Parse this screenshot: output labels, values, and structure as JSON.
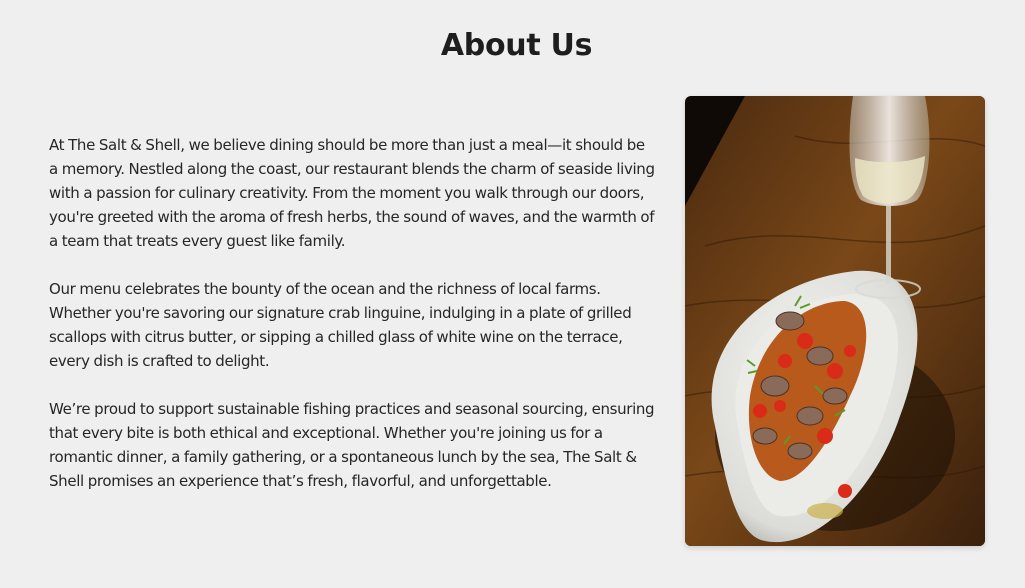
{
  "about": {
    "title": "About Us",
    "paragraphs": [
      "At The Salt & Shell, we believe dining should be more than just a meal—it should be a memory. Nestled along the coast, our restaurant blends the charm of seaside living with a passion for culinary creativity. From the moment you walk through our doors, you're greeted with the aroma of fresh herbs, the sound of waves, and the warmth of a team that treats every guest like family.",
      "Our menu celebrates the bounty of the ocean and the richness of local farms. Whether you're savoring our signature crab linguine, indulging in a plate of grilled scallops with citrus butter, or sipping a chilled glass of white wine on the terrace, every dish is crafted to delight.",
      "We’re proud to support sustainable fishing practices and seasonal sourcing, ensuring that every bite is both ethical and exceptional. Whether you're joining us for a romantic dinner, a family gathering, or a spontaneous lunch by the sea, The Salt & Shell promises an experience that’s fresh, flavorful, and unforgettable."
    ]
  }
}
